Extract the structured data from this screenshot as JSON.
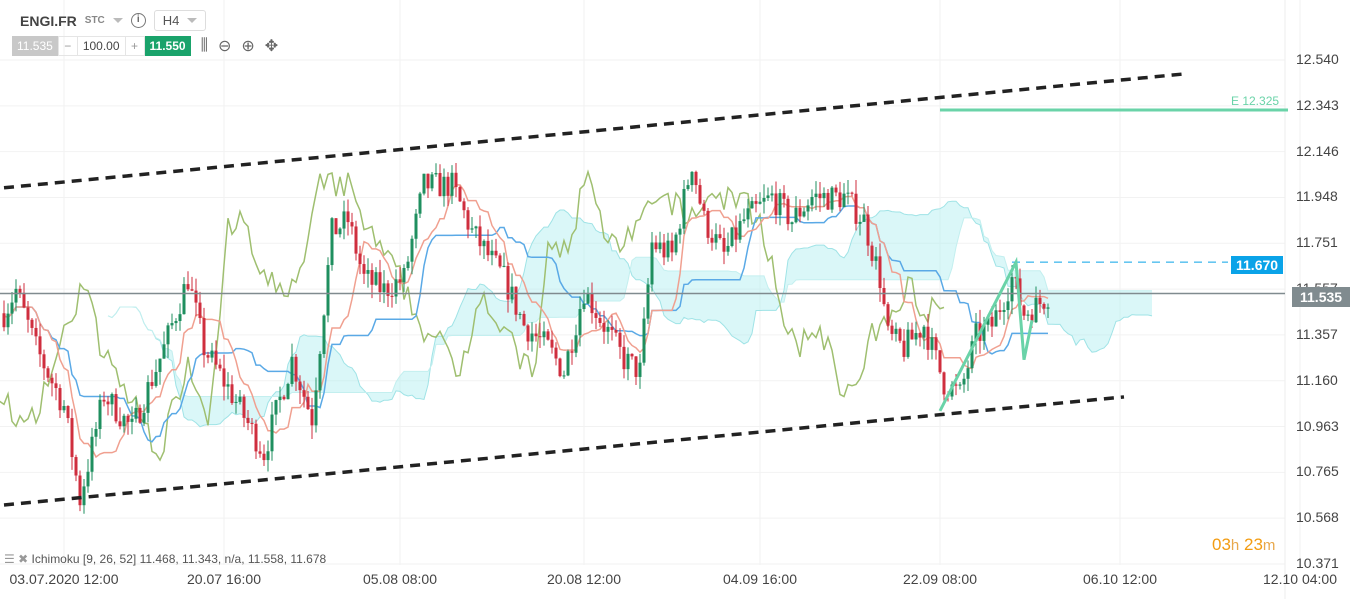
{
  "header": {
    "symbol": "ENGI.FR",
    "type": "STC",
    "info": "i",
    "timeframe": "H4"
  },
  "trade": {
    "sell": "11.535",
    "minus": "−",
    "quantity": "100.00",
    "plus": "+",
    "buy": "11.550"
  },
  "tools": [
    "candles-icon",
    "zoom-out-icon",
    "zoom-in-icon",
    "move-icon"
  ],
  "indicator": {
    "text": "Ichimoku [9, 26, 52] 11.468, 11.343, n/a, 11.558, 11.678"
  },
  "countdown": {
    "h": "03",
    "hu": "h",
    "m": "23",
    "mu": "m"
  },
  "colors": {
    "up": "#1f8f5f",
    "down": "#cf2e3e",
    "tenkan": "#f0a090",
    "kijun": "#5aa9e6",
    "chikou": "#9fbf70",
    "cloud": "#aeeef0",
    "current": "#808b8f",
    "target": "#6ad3a8",
    "level": "#0aa3e8"
  },
  "chart_data": {
    "type": "candlestick",
    "ylim": [
      10.371,
      12.54
    ],
    "yticks": [
      "12.540",
      "12.343",
      "12.146",
      "11.948",
      "11.751",
      "11.557",
      "11.357",
      "11.160",
      "10.963",
      "10.765",
      "10.568",
      "10.371"
    ],
    "xticks": [
      {
        "i": 15,
        "label": "03.07.2020 12:00"
      },
      {
        "i": 55,
        "label": "20.07 16:00"
      },
      {
        "i": 99,
        "label": "05.08 08:00"
      },
      {
        "i": 145,
        "label": "20.08 12:00"
      },
      {
        "i": 189,
        "label": "04.09 16:00"
      },
      {
        "i": 234,
        "label": "22.09 08:00"
      },
      {
        "i": 279,
        "label": "06.10 12:00"
      },
      {
        "i": 324,
        "label": "12.10 04:00"
      }
    ],
    "path": [
      [
        0,
        11.45
      ],
      [
        3,
        11.55
      ],
      [
        8,
        11.3
      ],
      [
        15,
        11.05
      ],
      [
        19,
        10.65
      ],
      [
        25,
        11.1
      ],
      [
        32,
        10.95
      ],
      [
        40,
        11.3
      ],
      [
        46,
        11.6
      ],
      [
        50,
        11.3
      ],
      [
        57,
        11.1
      ],
      [
        65,
        10.85
      ],
      [
        72,
        11.25
      ],
      [
        77,
        11.0
      ],
      [
        82,
        11.8
      ],
      [
        86,
        11.85
      ],
      [
        90,
        11.6
      ],
      [
        95,
        11.55
      ],
      [
        100,
        11.6
      ],
      [
        105,
        12.0
      ],
      [
        112,
        12.0
      ],
      [
        117,
        11.8
      ],
      [
        125,
        11.6
      ],
      [
        130,
        11.4
      ],
      [
        136,
        11.3
      ],
      [
        140,
        11.2
      ],
      [
        145,
        11.55
      ],
      [
        150,
        11.4
      ],
      [
        155,
        11.25
      ],
      [
        159,
        11.2
      ],
      [
        162,
        11.75
      ],
      [
        167,
        11.7
      ],
      [
        172,
        12.1
      ],
      [
        175,
        11.85
      ],
      [
        180,
        11.7
      ],
      [
        185,
        11.85
      ],
      [
        192,
        11.95
      ],
      [
        197,
        11.85
      ],
      [
        202,
        11.95
      ],
      [
        210,
        11.95
      ],
      [
        215,
        11.85
      ],
      [
        219,
        11.6
      ],
      [
        221,
        11.35
      ],
      [
        225,
        11.3
      ],
      [
        230,
        11.4
      ],
      [
        235,
        11.15
      ],
      [
        239,
        11.1
      ],
      [
        243,
        11.35
      ],
      [
        247,
        11.4
      ],
      [
        252,
        11.6
      ],
      [
        255,
        11.45
      ],
      [
        258,
        11.48
      ],
      [
        261,
        11.53
      ]
    ],
    "current_price": 11.535,
    "current_label": "11.535",
    "level": {
      "price": 11.67,
      "label": "11.670",
      "from": 252,
      "to": 306
    },
    "target": {
      "price": 12.325,
      "label": "E 12.325",
      "from": 234,
      "to": 321
    },
    "channel": {
      "upper": [
        [
          0,
          11.99
        ],
        [
          295,
          12.48
        ]
      ],
      "lower": [
        [
          0,
          10.625
        ],
        [
          280,
          11.09
        ]
      ]
    },
    "zigzag": [
      [
        234,
        11.03
      ],
      [
        253,
        11.67
      ],
      [
        255,
        11.25
      ],
      [
        257,
        11.42
      ]
    ]
  }
}
